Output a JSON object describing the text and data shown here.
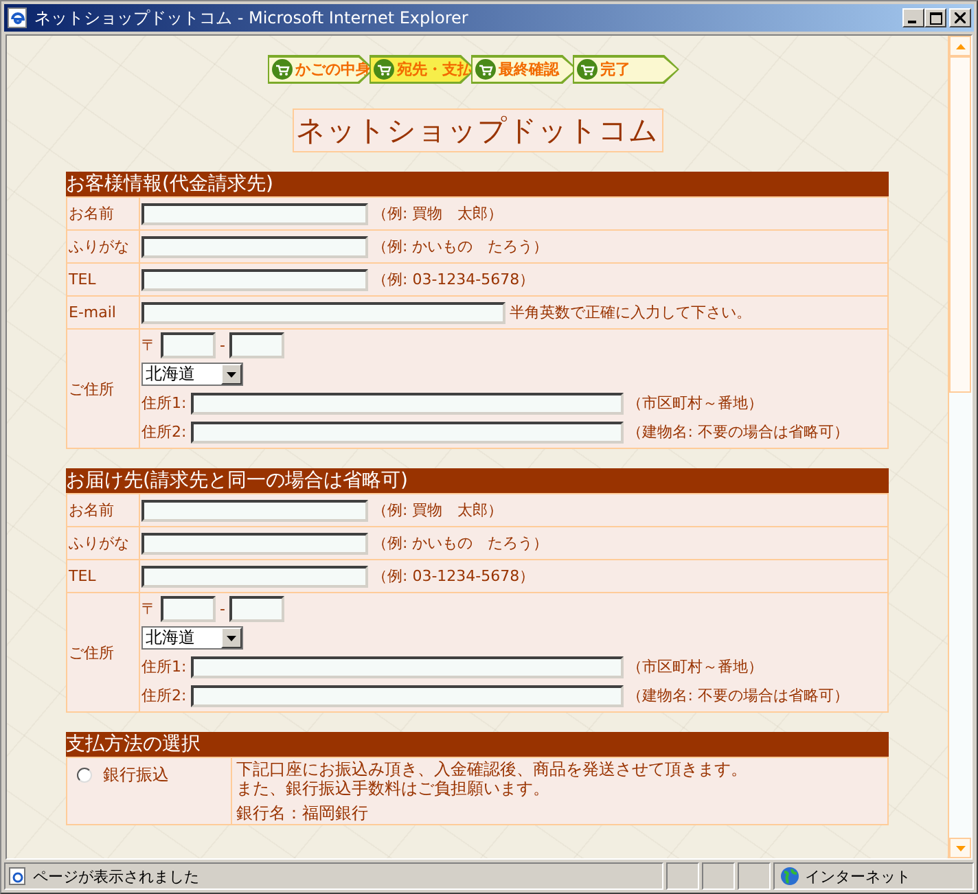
{
  "window": {
    "title": "ネットショップドットコム - Microsoft Internet Explorer"
  },
  "steps": [
    {
      "label": "かごの中身",
      "selected": false
    },
    {
      "label": "宛先・支払",
      "selected": true
    },
    {
      "label": "最終確認",
      "selected": false
    },
    {
      "label": "完了",
      "selected": false
    }
  ],
  "shop_title": "ネットショップドットコム",
  "sections": [
    {
      "title": "お客様情報(代金請求先)",
      "rows": [
        {
          "kind": "text",
          "label": "お名前",
          "hint": "（例: 買物　太郎）"
        },
        {
          "kind": "text",
          "label": "ふりがな",
          "hint": "（例: かいもの　たろう）"
        },
        {
          "kind": "text",
          "label": "TEL",
          "hint": "（例: 03-1234-5678）"
        },
        {
          "kind": "email",
          "label": "E-mail",
          "hint": "半角英数で正確に入力して下さい。"
        },
        {
          "kind": "address",
          "label": "ご住所",
          "postal_mark": "〒",
          "dash": "-",
          "prefecture": "北海道",
          "address1_label": "住所1:",
          "address1_hint": "（市区町村～番地）",
          "address2_label": "住所2:",
          "address2_hint": "（建物名: 不要の場合は省略可）"
        }
      ]
    },
    {
      "title": "お届け先(請求先と同一の場合は省略可)",
      "rows": [
        {
          "kind": "text",
          "label": "お名前",
          "hint": "（例: 買物　太郎）"
        },
        {
          "kind": "text",
          "label": "ふりがな",
          "hint": "（例: かいもの　たろう）"
        },
        {
          "kind": "text",
          "label": "TEL",
          "hint": "（例: 03-1234-5678）"
        },
        {
          "kind": "address",
          "label": "ご住所",
          "postal_mark": "〒",
          "dash": "-",
          "prefecture": "北海道",
          "address1_label": "住所1:",
          "address1_hint": "（市区町村～番地）",
          "address2_label": "住所2:",
          "address2_hint": "（建物名: 不要の場合は省略可）"
        }
      ]
    }
  ],
  "payment": {
    "title": "支払方法の選択",
    "options": [
      {
        "label": "銀行振込",
        "selected": false,
        "description": [
          "下記口座にお振込み頂き、入金確認後、商品を発送させて頂きます。",
          "また、銀行振込手数料はご負担願います。"
        ],
        "bank": "銀行名：福岡銀行"
      }
    ]
  },
  "status_bar": {
    "text": "ページが表示されました",
    "zone": "インターネット"
  }
}
